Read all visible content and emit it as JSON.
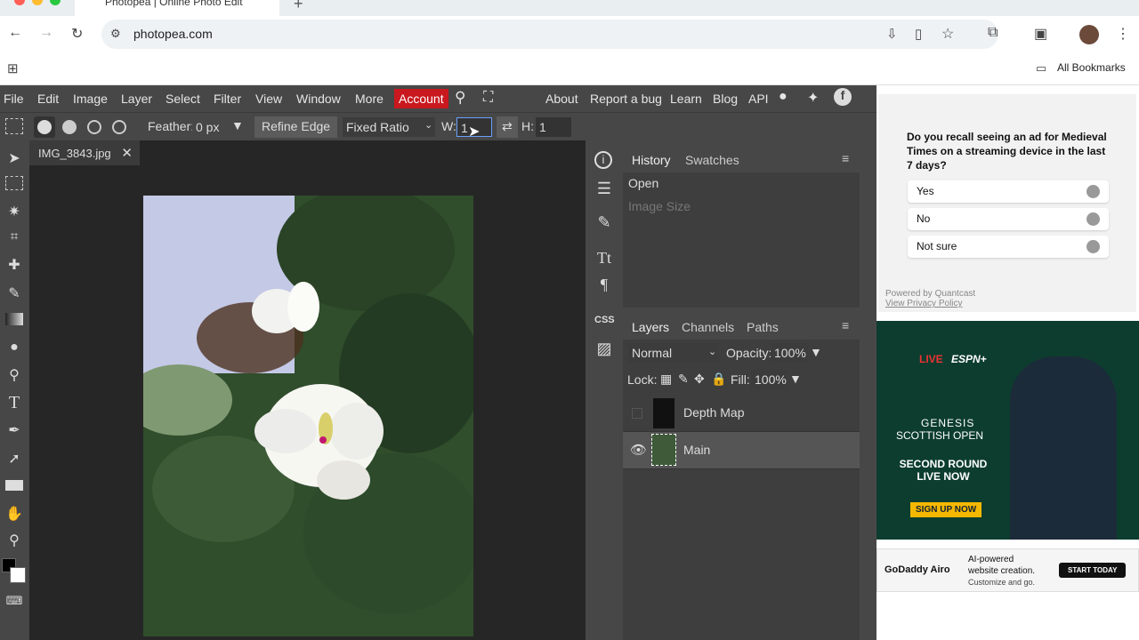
{
  "browser": {
    "tab_title": "Photopea | Online Photo Edit",
    "url": "photopea.com",
    "bookmarks": "All Bookmarks"
  },
  "menu": {
    "items": [
      "File",
      "Edit",
      "Image",
      "Layer",
      "Select",
      "Filter",
      "View",
      "Window",
      "More"
    ],
    "account": "Account",
    "right": [
      "About",
      "Report a bug",
      "Learn",
      "Blog",
      "API"
    ]
  },
  "options": {
    "feather_label": "Feather:",
    "feather_value": "0 px",
    "refine": "Refine Edge",
    "ratio": "Fixed Ratio",
    "w_label": "W:",
    "w_value": "1",
    "h_label": "H:",
    "h_value": "1"
  },
  "document": {
    "tab": "IMG_3843.jpg"
  },
  "history": {
    "tabs": [
      "History",
      "Swatches"
    ],
    "items": [
      "Open",
      "Image Size"
    ]
  },
  "layers": {
    "tabs": [
      "Layers",
      "Channels",
      "Paths"
    ],
    "blend": "Normal",
    "opacity_label": "Opacity:",
    "opacity": "100%",
    "lock_label": "Lock:",
    "fill_label": "Fill:",
    "fill": "100%",
    "rows": [
      "Depth Map",
      "Main"
    ]
  },
  "ad1": {
    "question": "Do you recall seeing an ad for Medieval Times on a streaming device in the last 7 days?",
    "options": [
      "Yes",
      "No",
      "Not sure"
    ],
    "powered": "Powered by Quantcast",
    "privacy": "View Privacy Policy"
  },
  "ad2": {
    "live": "LIVE",
    "network": "ESPN+",
    "brand": "GENESIS",
    "event": "SCOTTISH OPEN",
    "headline": "SECOND ROUND LIVE NOW",
    "cta": "SIGN UP NOW"
  },
  "ad3": {
    "brand": "GoDaddy Airo",
    "line1": "AI-powered",
    "line2": "website creation.",
    "line3": "Customize and go.",
    "cta": "START TODAY"
  }
}
